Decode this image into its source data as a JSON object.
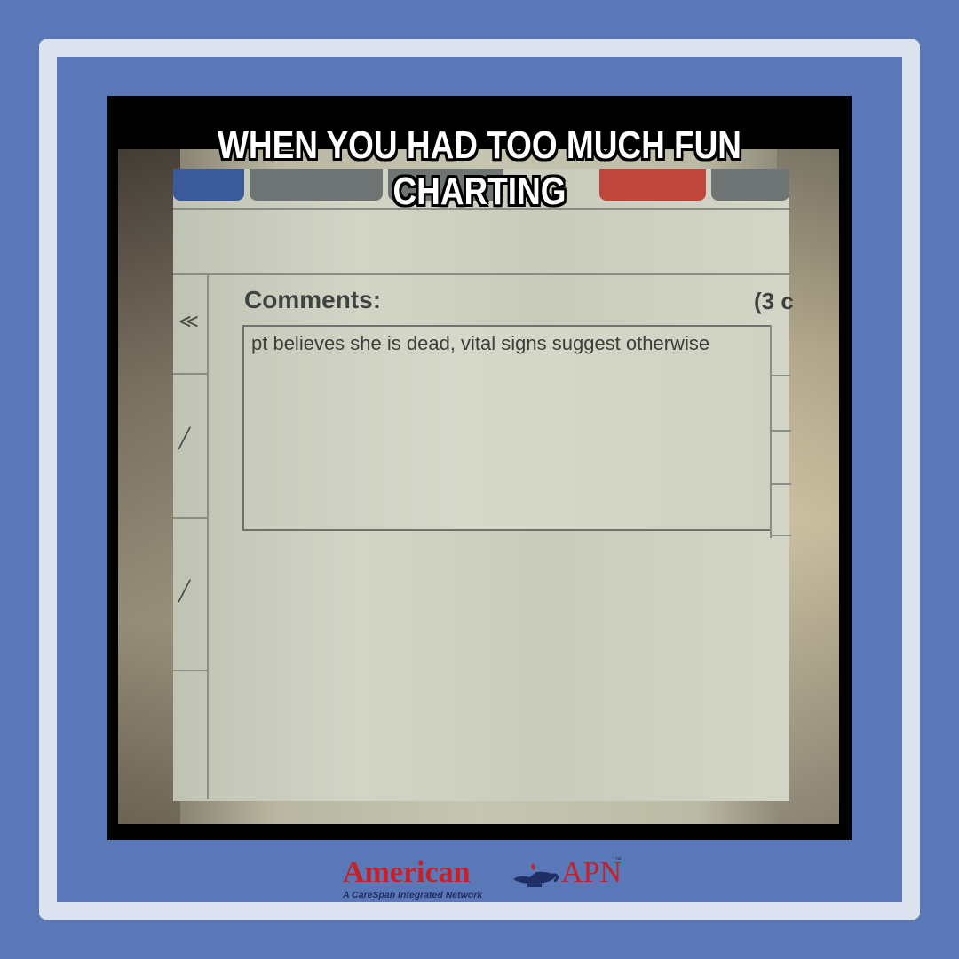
{
  "meme": {
    "caption_line1": "WHEN YOU HAD TOO MUCH FUN",
    "caption_line2": "CHARTING"
  },
  "screen": {
    "comments_label": "Comments:",
    "count_label": "(3 c",
    "comment_text": "pt believes she is dead, vital signs suggest otherwise",
    "tab_colors": [
      "#3b5a9a",
      "#6e7373",
      "#6e7373",
      "#c0463b",
      "#6e7373"
    ]
  },
  "logo": {
    "brand_word": "American",
    "brand_suffix": "APN",
    "trademark": "™",
    "tagline": "A CareSpan Integrated Network",
    "icon": "oil-lamp-icon"
  },
  "colors": {
    "background": "#5a78b8",
    "frame": "#dde2ef",
    "brand_red": "#c62127",
    "brand_navy": "#1f2f66"
  }
}
